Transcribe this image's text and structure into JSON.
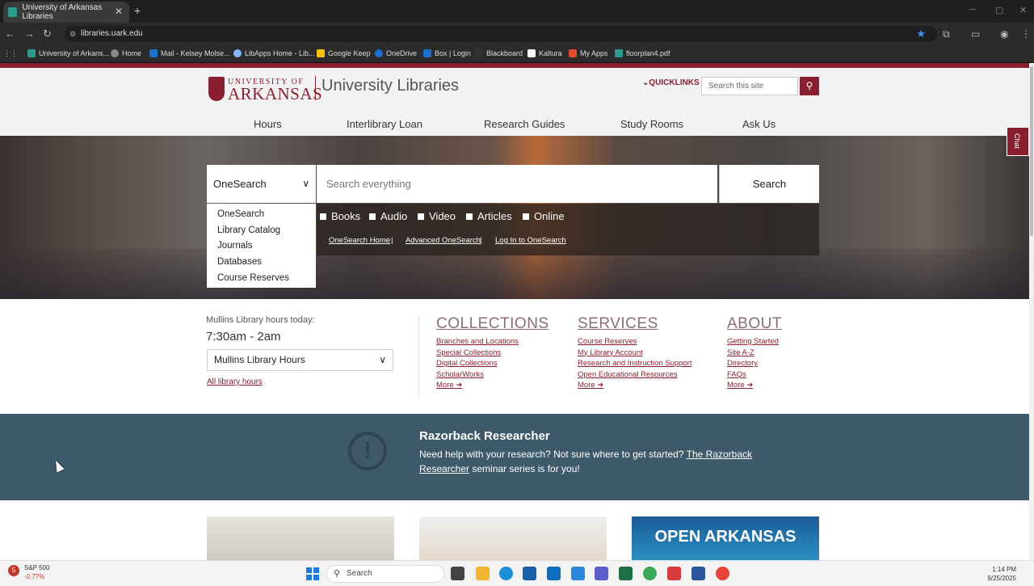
{
  "browser": {
    "tab_title": "University of Arkansas Libraries",
    "tab_close": "✕",
    "new_tab": "+",
    "url": "libraries.uark.edu",
    "bookmarks": [
      "University of Arkans...",
      "Home",
      "Mail - Kelsey Molse...",
      "LibApps Home - Lib...",
      "Google Keep",
      "OneDrive",
      "Box | Login",
      "Blackboard",
      "Kaltura",
      "My Apps",
      "floorplan4.pdf"
    ]
  },
  "header": {
    "logo_small": "UNIVERSITY OF",
    "logo_large": "ARKANSAS",
    "site_title": "University Libraries",
    "quicklinks": "QUICKLINKS",
    "site_search_placeholder": "Search this site"
  },
  "nav": {
    "items": [
      "Hours",
      "Interlibrary Loan",
      "Research Guides",
      "Study Rooms",
      "Ask Us"
    ]
  },
  "onesearch": {
    "selected": "OneSearch",
    "input_placeholder": "Search everything",
    "search_button": "Search",
    "options": [
      "OneSearch",
      "Library Catalog",
      "Journals",
      "Databases",
      "Course Reserves"
    ],
    "filters": [
      "Books",
      "Audio",
      "Video",
      "Articles",
      "Online"
    ],
    "links": [
      "OneSearch Home",
      "Advanced OneSearch",
      "Log In to OneSearch"
    ],
    "separator": "|"
  },
  "hours": {
    "label": "Mullins Library hours today:",
    "time": "7:30am - 2am",
    "select": "Mullins Library Hours",
    "all_link": "All library hours"
  },
  "collections": {
    "heading": "COLLECTIONS",
    "links": [
      "Branches and Locations",
      "Special Collections",
      "Digital Collections",
      "ScholarWorks",
      "More"
    ]
  },
  "services": {
    "heading": "SERVICES",
    "links": [
      "Course Reserves",
      "My Library Account",
      "Research and Instruction Support",
      "Open Educational Resources",
      "More"
    ]
  },
  "about": {
    "heading": "ABOUT",
    "links": [
      "Getting Started",
      "Site A-Z",
      "Directory",
      "FAQs",
      "More"
    ]
  },
  "razorback": {
    "title": "Razorback Researcher",
    "text_before": "Need help with your research? Not sure where to get started? ",
    "link": "The Razorback Researcher",
    "text_after": " seminar series is for you!"
  },
  "cards": {
    "open_arkansas": "OPEN ARKANSAS"
  },
  "chat": "Chat",
  "taskbar": {
    "stock_name": "S&P 500",
    "stock_change": "-0.77%",
    "stock_badge": "5",
    "search": "Search",
    "time": "1:14 PM",
    "date": "9/25/2025"
  },
  "colors": {
    "brand": "#8a1f2f",
    "band": "#3e5a6a"
  }
}
